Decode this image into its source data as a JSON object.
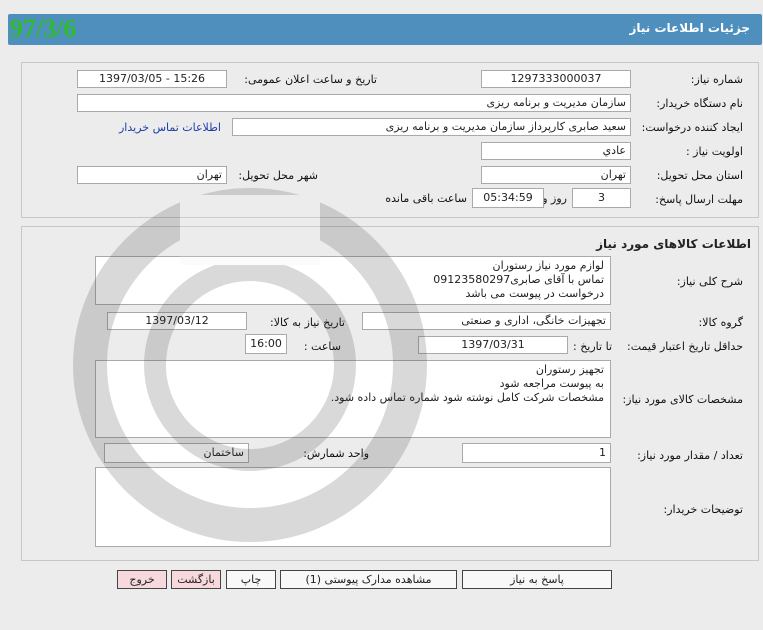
{
  "header": {
    "title": "جزئيات اطلاعات نياز",
    "date_stamp": "97/3/6"
  },
  "info": {
    "need_number_label": "شماره نياز:",
    "need_number": "1297333000037",
    "announce_label": "تاريخ و ساعت اعلان عمومی:",
    "announce_value": "1397/03/05 - 15:26",
    "buyer_org_label": "نام دستگاه خريدار:",
    "buyer_org": "سازمان مديريت و برنامه ريزی",
    "creator_label": "ايجاد کننده درخواست:",
    "creator": "سعيد صابری کارپرداز سازمان مديريت و برنامه ريزی",
    "contact_link": "اطلاعات تماس خريدار",
    "priority_label": "اولويت نياز :",
    "priority": "عادي",
    "province_label": "استان محل تحويل:",
    "province": "تهران",
    "city_label": "شهر محل تحويل:",
    "city": "تهران",
    "deadline_label": "مهلت ارسال پاسخ:",
    "deadline_days": "3",
    "days_word": "روز و",
    "deadline_time": "05:34:59",
    "remaining_word": "ساعت باقی مانده"
  },
  "goods": {
    "section_title": "اطلاعات کالاهای مورد نياز",
    "summary_label": "شرح کلی نياز:",
    "summary_lines": [
      "لوازم مورد نياز رستوران",
      "تماس با آقای صابری09123580297",
      "درخواست در پيوست می باشد"
    ],
    "group_label": "گروه کالا:",
    "group": "تجهيزات خانگی، اداری و صنعتی",
    "need_date_label": "تاريخ نياز به کالا:",
    "need_date": "1397/03/12",
    "min_price_label": "حداقل تاريخ اعتبار قيمت:",
    "until_date_label": "تا تاريخ :",
    "until_date": "1397/03/31",
    "time_label": "ساعت :",
    "time": "16:00",
    "specs_label": "مشخصات کالای مورد نياز:",
    "specs_lines": [
      "تجهيز رستوران",
      "به پيوست مراجعه شود",
      "مشخصات شرکت کامل نوشته شود شماره تماس داده شود."
    ],
    "qty_label": "تعداد / مقدار مورد نياز:",
    "qty": "1",
    "unit_label": "واحد شمارش:",
    "unit": "ساختمان",
    "buyer_notes_label": "توضيحات خريدار:",
    "buyer_notes": ""
  },
  "buttons": {
    "reply": "پاسخ به نياز",
    "attachments": "مشاهده مدارک پيوستی (1)",
    "print": "چاپ",
    "back": "بازگشت",
    "exit": "خروج"
  },
  "watermark": {
    "icon": "hezareh-logo-watermark"
  }
}
